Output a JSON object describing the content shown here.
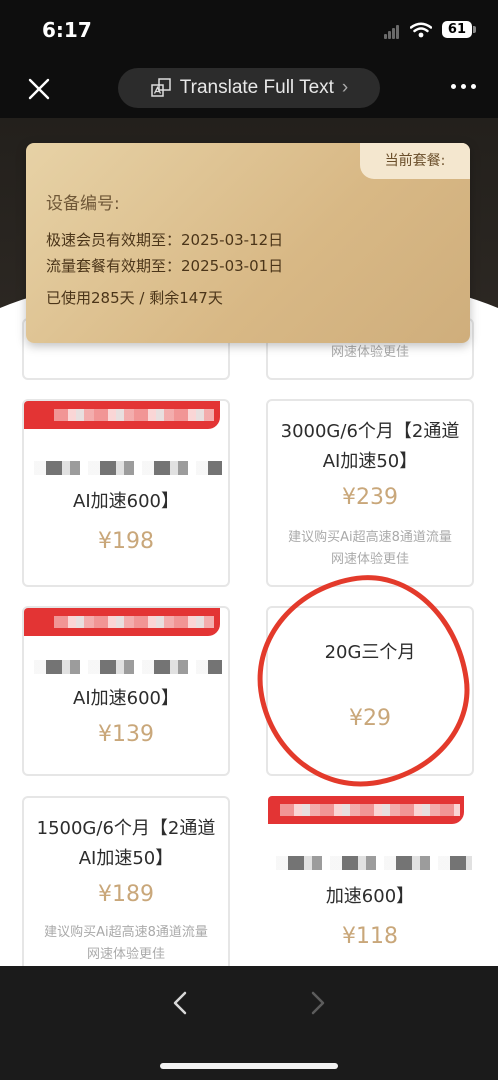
{
  "status_bar": {
    "time": "6:17",
    "battery": "61"
  },
  "top_nav": {
    "translate_label": "Translate Full Text",
    "translate_chevron": "›"
  },
  "membership": {
    "badge": "当前套餐:",
    "device_label": "设备编号:",
    "vip_expiry": "极速会员有效期至：2025-03-12日",
    "data_expiry": "流量套餐有效期至：2025-03-01日",
    "usage": "已使用285天 / 剩余147天"
  },
  "plans": [
    {
      "line2": "AI加速600】",
      "price": "¥198"
    },
    {
      "line1": "3000G/6个月【2通道",
      "line2": "AI加速50】",
      "price": "¥239",
      "note1": "建议购买Ai超高速8通道流量",
      "note2": "网速体验更佳"
    },
    {
      "line2": "AI加速600】",
      "price": "¥139"
    },
    {
      "line1": "20G三个月",
      "price": "¥29"
    },
    {
      "line1": "1500G/6个月【2通道",
      "line2": "AI加速50】",
      "price": "¥189",
      "note1": "建议购买Ai超高速8通道流量",
      "note2": "网速体验更佳"
    },
    {
      "line2": "加速600】",
      "price": "¥118"
    }
  ],
  "partial_top_right_note": "网速体验更佳",
  "icons": [
    "close-icon",
    "translate-icon",
    "more-icon",
    "back-arrow-icon",
    "forward-arrow-icon",
    "wifi-icon",
    "signal-icon"
  ],
  "colors": {
    "price": "#c9a77a",
    "accent_red": "#e33434",
    "card_gold": "#d8b885"
  }
}
